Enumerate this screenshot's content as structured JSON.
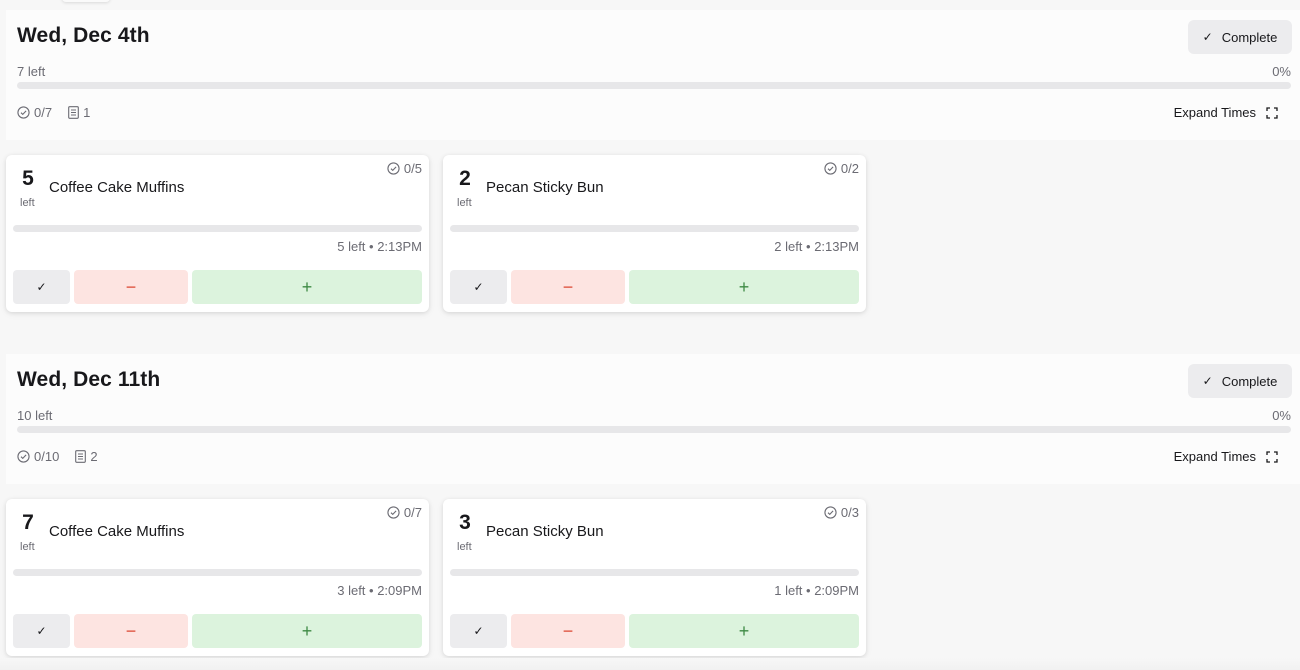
{
  "days": [
    {
      "title": "Wed, Dec 4th",
      "complete_label": "Complete",
      "left_text": "7 left",
      "percent_text": "0%",
      "progress_fraction": 0,
      "done_count": "0/7",
      "notes_count": "1",
      "expand_label": "Expand Times",
      "items": [
        {
          "count": "5",
          "count_label": "left",
          "name": "Coffee Cake Muffins",
          "done": "0/5",
          "progress_fraction": 0,
          "status": "5 left • 2:13PM"
        },
        {
          "count": "2",
          "count_label": "left",
          "name": "Pecan Sticky Bun",
          "done": "0/2",
          "progress_fraction": 0,
          "status": "2 left • 2:13PM"
        }
      ]
    },
    {
      "title": "Wed, Dec 11th",
      "complete_label": "Complete",
      "left_text": "10 left",
      "percent_text": "0%",
      "progress_fraction": 0,
      "done_count": "0/10",
      "notes_count": "2",
      "expand_label": "Expand Times",
      "items": [
        {
          "count": "7",
          "count_label": "left",
          "name": "Coffee Cake Muffins",
          "done": "0/7",
          "progress_fraction": 0,
          "status": "3 left • 2:09PM"
        },
        {
          "count": "3",
          "count_label": "left",
          "name": "Pecan Sticky Bun",
          "done": "0/3",
          "progress_fraction": 0,
          "status": "1 left • 2:09PM"
        }
      ]
    }
  ],
  "icons": {
    "check": "✓",
    "minus": "−",
    "plus": "+"
  },
  "colors": {
    "minus_accent": "#dc4b36",
    "plus_accent": "#3e8a44",
    "minus_bg": "#fde4e1",
    "plus_bg": "#dcf3dd"
  }
}
